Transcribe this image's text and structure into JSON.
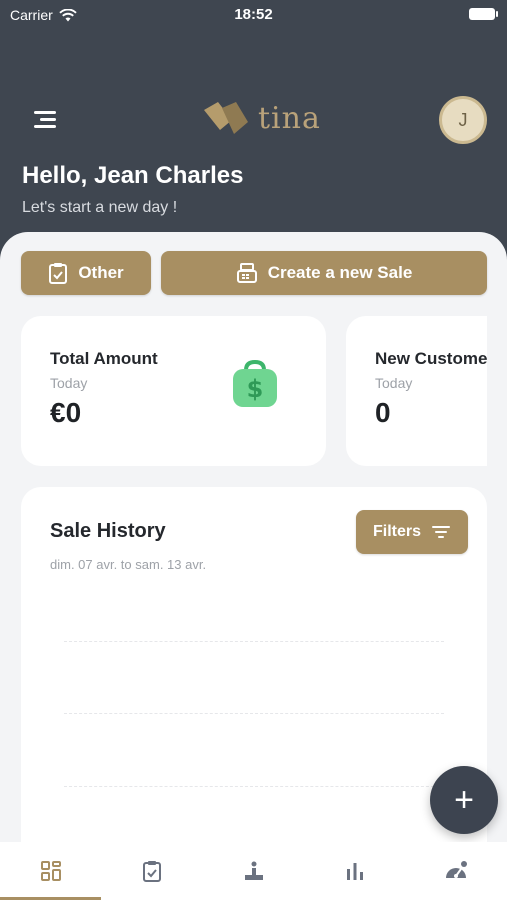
{
  "status_bar": {
    "carrier": "Carrier",
    "time": "18:52"
  },
  "header": {
    "logo_text": "tina",
    "avatar_initial": "J"
  },
  "greeting": {
    "title": "Hello, Jean Charles",
    "subtitle": "Let's start a new day !"
  },
  "actions": {
    "other_label": "Other",
    "create_label": "Create a new Sale"
  },
  "cards": [
    {
      "title": "Total Amount",
      "period": "Today",
      "value": "€0",
      "icon": "money-bag-icon"
    },
    {
      "title": "New Customers",
      "period": "Today",
      "value": "0"
    }
  ],
  "sales_history": {
    "title": "Sale History",
    "range": "dim. 07 avr. to sam. 13 avr.",
    "filters_label": "Filters"
  },
  "fab": {
    "label": "+"
  },
  "tabs": [
    {
      "icon": "dashboard-icon",
      "active": true
    },
    {
      "icon": "clipboard-check-icon",
      "active": false
    },
    {
      "icon": "leaderboard-icon",
      "active": false
    },
    {
      "icon": "bar-chart-icon",
      "active": false
    },
    {
      "icon": "speedometer-icon",
      "active": false
    }
  ],
  "colors": {
    "header_bg": "#3f4650",
    "accent_gold": "#a88f62",
    "panel_bg": "#f3f4f6",
    "money_green": "#6fd591"
  }
}
